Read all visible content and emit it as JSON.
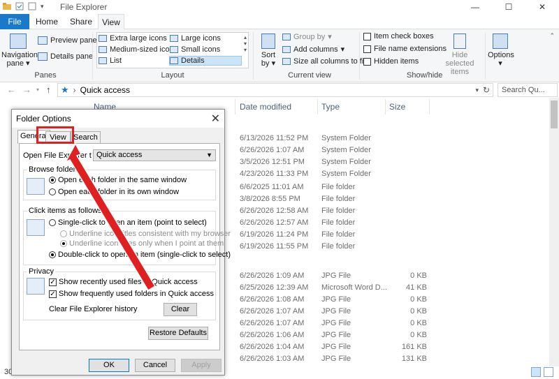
{
  "window": {
    "title": "File Explorer",
    "controls": [
      "—",
      "☐",
      "✕"
    ]
  },
  "ribbon_tabs": [
    "File",
    "Home",
    "Share",
    "View"
  ],
  "ribbon": {
    "panes": {
      "navigation_pane": "Navigation pane",
      "preview_pane": "Preview pane",
      "details_pane": "Details pane",
      "label": "Panes"
    },
    "layout": {
      "items": [
        "Extra large icons",
        "Large icons",
        "Medium-sized icons",
        "Small icons",
        "List",
        "Details"
      ],
      "selected": "Details",
      "label": "Layout"
    },
    "current_view": {
      "sort_by": "Sort by",
      "group_by": "Group by",
      "add_columns": "Add columns",
      "size_all": "Size all columns to fit",
      "label": "Current view"
    },
    "show_hide": {
      "item_check_boxes": "Item check boxes",
      "file_name_extensions": "File name extensions",
      "hidden_items": "Hidden items",
      "hide_selected": "Hide selected items",
      "label": "Show/hide"
    },
    "options": "Options"
  },
  "address": {
    "path": "Quick access",
    "search_placeholder": "Search Qu..."
  },
  "columns": {
    "name": "Name",
    "date": "Date modified",
    "type": "Type",
    "size": "Size"
  },
  "rows": [
    {
      "date": "6/13/2026 11:52 PM",
      "type": "System Folder",
      "size": ""
    },
    {
      "date": "6/26/2026 1:07 AM",
      "type": "System Folder",
      "size": ""
    },
    {
      "date": "3/5/2026 12:51 PM",
      "type": "System Folder",
      "size": ""
    },
    {
      "date": "4/23/2026 11:33 PM",
      "type": "System Folder",
      "size": ""
    },
    {
      "date": "6/6/2025 11:01 AM",
      "type": "File folder",
      "size": ""
    },
    {
      "date": "3/8/2026 8:55 PM",
      "type": "File folder",
      "size": ""
    },
    {
      "date": "6/26/2026 12:58 AM",
      "type": "File folder",
      "size": ""
    },
    {
      "date": "6/26/2026 12:57 AM",
      "type": "File folder",
      "size": ""
    },
    {
      "date": "6/19/2026 11:24 PM",
      "type": "File folder",
      "size": ""
    },
    {
      "date": "6/19/2026 11:55 PM",
      "type": "File folder",
      "size": ""
    },
    {
      "date": "6/26/2026 1:09 AM",
      "type": "JPG File",
      "size": "0 KB"
    },
    {
      "date": "6/25/2026 12:39 AM",
      "type": "Microsoft Word D...",
      "size": "41 KB"
    },
    {
      "date": "6/26/2026 1:08 AM",
      "type": "JPG File",
      "size": "0 KB"
    },
    {
      "date": "6/26/2026 1:07 AM",
      "type": "JPG File",
      "size": "0 KB"
    },
    {
      "date": "6/26/2026 1:07 AM",
      "type": "JPG File",
      "size": "0 KB"
    },
    {
      "date": "6/26/2026 1:06 AM",
      "type": "JPG File",
      "size": "0 KB"
    },
    {
      "date": "6/26/2026 1:04 AM",
      "type": "JPG File",
      "size": "161 KB"
    },
    {
      "date": "6/26/2026 1:03 AM",
      "type": "JPG File",
      "size": "131 KB"
    }
  ],
  "status": {
    "item_count": "30"
  },
  "dialog": {
    "title": "Folder Options",
    "tabs": [
      "General",
      "View",
      "Search"
    ],
    "open_label": "Open File Explorer t",
    "open_value": "Quick access",
    "browse": {
      "legend": "Browse folders",
      "same": "Open each folder in the same window",
      "own": "Open each folder in its own window"
    },
    "click": {
      "legend": "Click items as follows",
      "single": "Single-click to open an item (point to select)",
      "u1": "Underline icon titles consistent with my browser",
      "u2": "Underline icon titles only when I point at them",
      "double": "Double-click to open an item (single-click to select)"
    },
    "privacy": {
      "legend": "Privacy",
      "recent": "Show recently used files in Quick access",
      "frequent": "Show frequently used folders in Quick access",
      "clear_label": "Clear File Explorer history",
      "clear_btn": "Clear"
    },
    "restore": "Restore Defaults",
    "ok": "OK",
    "cancel": "Cancel",
    "apply": "Apply"
  },
  "colors": {
    "accent": "#1979ca",
    "highlight": "#e02020"
  }
}
